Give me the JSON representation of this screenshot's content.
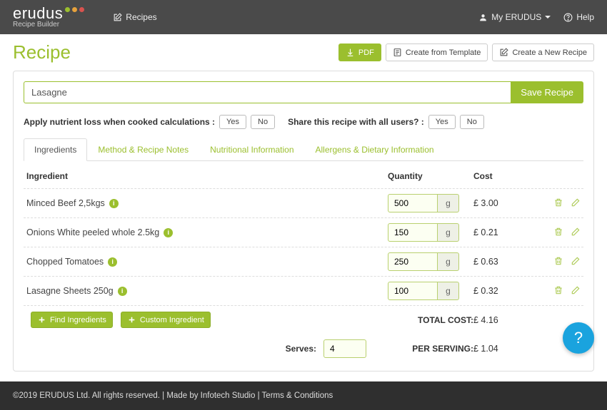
{
  "brand": {
    "name": "erudus",
    "subtitle": "Recipe Builder"
  },
  "nav": {
    "recipes": "Recipes",
    "my_account": "My ERUDUS",
    "help": "Help"
  },
  "header": {
    "title": "Recipe",
    "pdf_btn": "PDF",
    "template_btn": "Create from Template",
    "new_btn": "Create a New Recipe"
  },
  "form": {
    "title_value": "Lasagne",
    "save_btn": "Save Recipe",
    "nutrient_loss_label": "Apply nutrient loss when cooked calculations :",
    "share_label": "Share this recipe with all users? :",
    "yes": "Yes",
    "no": "No"
  },
  "tabs": {
    "ingredients": "Ingredients",
    "method": "Method & Recipe Notes",
    "nutrition": "Nutritional Information",
    "allergens": "Allergens & Dietary Information"
  },
  "columns": {
    "ingredient": "Ingredient",
    "quantity": "Quantity",
    "cost": "Cost"
  },
  "ingredients": [
    {
      "name": "Minced Beef 2,5kgs",
      "qty": "500",
      "unit": "g",
      "cost": "£ 3.00"
    },
    {
      "name": "Onions White peeled whole 2.5kg",
      "qty": "150",
      "unit": "g",
      "cost": "£ 0.21"
    },
    {
      "name": "Chopped Tomatoes",
      "qty": "250",
      "unit": "g",
      "cost": "£ 0.63"
    },
    {
      "name": "Lasagne Sheets 250g",
      "qty": "100",
      "unit": "g",
      "cost": "£ 0.32"
    }
  ],
  "actions": {
    "find": "Find Ingredients",
    "custom": "Custom Ingredient"
  },
  "totals": {
    "total_label": "TOTAL COST:",
    "total_value": "£ 4.16",
    "serves_label": "Serves:",
    "serves_value": "4",
    "per_serving_label": "PER SERVING:",
    "per_serving_value": "£ 1.04"
  },
  "footer": {
    "text": "©2019 ERUDUS Ltd. All rights reserved. | Made by Infotech Studio | Terms & Conditions"
  }
}
